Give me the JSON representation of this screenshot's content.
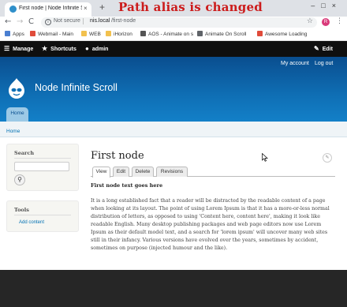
{
  "browser": {
    "tab_title": "First node | Node Infinite Scroll",
    "tab_close": "×",
    "new_tab": "+",
    "window_controls": "–□×",
    "back": "←",
    "forward": "→",
    "reload": "C",
    "info": "i",
    "security": "Not secure",
    "url_separator": "|",
    "url_host": "nis.local",
    "url_path": "/first-node",
    "star": "☆",
    "avatar_letter": "R",
    "menu": "⋮"
  },
  "overlay_caption": "Path alias is changed",
  "bookmarks": [
    {
      "label": "Apps",
      "color": "#4a7fd1"
    },
    {
      "label": "Webmail - Main",
      "color": "#e04b3a"
    },
    {
      "label": "WEB",
      "color": "#f2c14e"
    },
    {
      "label": "iHorizon",
      "color": "#f2c14e"
    },
    {
      "label": "AOS - Animate on s",
      "color": "#555555"
    },
    {
      "label": "Animate On Scroll",
      "color": "#5f6368"
    },
    {
      "label": "Awesome Loading",
      "color": "#e04b3a"
    }
  ],
  "toolbar": {
    "manage": "Manage",
    "shortcuts": "Shortcuts",
    "user": "admin",
    "edit": "Edit"
  },
  "header": {
    "my_account": "My account",
    "log_out": "Log out",
    "site_name": "Node Infinite Scroll",
    "home_tab": "Home"
  },
  "breadcrumb": "Home",
  "sidebar": {
    "search_title": "Search",
    "search_button": "⚲",
    "tools_title": "Tools",
    "tools_link": "Add content"
  },
  "main": {
    "title": "First node",
    "edit_icon": "✎",
    "tabs": [
      "View",
      "Edit",
      "Delete",
      "Revisions"
    ],
    "subtitle": "First node text goes here",
    "body": "It is a long established fact that a reader will be distracted by the readable content of a page when looking at its layout. The point of using Lorem Ipsum is that it has a more-or-less normal distribution of letters, as opposed to using 'Content here, content here', making it look like readable English. Many desktop publishing packages and web page editors now use Lorem Ipsum as their default model text, and a search for 'lorem ipsum' will uncover many web sites still in their infancy. Various versions have evolved over the years, sometimes by accident, sometimes on purpose (injected humour and the like)."
  },
  "colors": {
    "toolbar": "#0f0f0f",
    "header": "#0f6fb5",
    "link": "#0071b3",
    "footer": "#262626",
    "caption": "#cc1c1c"
  }
}
